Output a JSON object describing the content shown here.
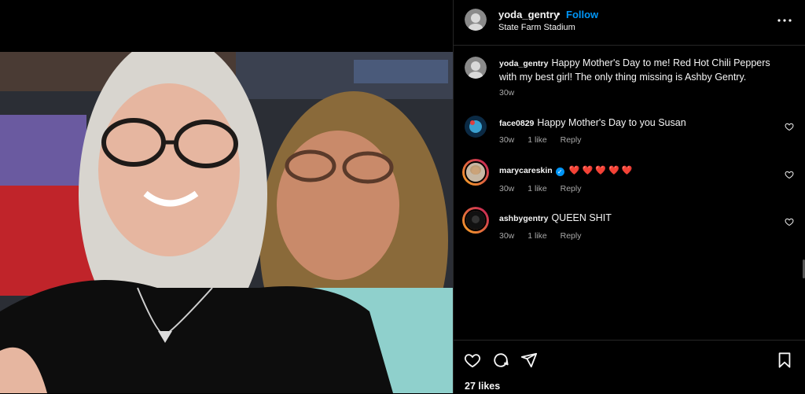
{
  "post": {
    "username": "yoda_gentry",
    "separator": "•",
    "follow_label": "Follow",
    "location": "State Farm Stadium",
    "photo_alt_icon": "selfie-photo"
  },
  "caption": {
    "username": "yoda_gentry",
    "text": "Happy Mother's Day to me! Red Hot Chili Peppers with my best girl! The only thing missing is Ashby Gentry.",
    "time": "30w"
  },
  "comments": [
    {
      "username": "face0829",
      "text": "Happy Mother's Day to you Susan",
      "time": "30w",
      "likes": "1 like",
      "reply": "Reply"
    },
    {
      "username": "marycareskin",
      "verified": true,
      "text": "❤️ ❤️ ❤️ ❤️ ❤️",
      "time": "30w",
      "likes": "1 like",
      "reply": "Reply"
    },
    {
      "username": "ashbygentry",
      "text": "QUEEN SHIT",
      "time": "30w",
      "likes": "1 like",
      "reply": "Reply"
    }
  ],
  "actions": {
    "icons": [
      "heart-icon",
      "comment-icon",
      "share-icon",
      "bookmark-icon"
    ],
    "likes": "27 likes"
  },
  "colors": {
    "accent": "#0095f6",
    "background": "#000000",
    "text": "#f5f5f5",
    "muted": "#a8a8a8",
    "story_ring_start": "#f9a825",
    "story_ring_end": "#c2185b"
  }
}
